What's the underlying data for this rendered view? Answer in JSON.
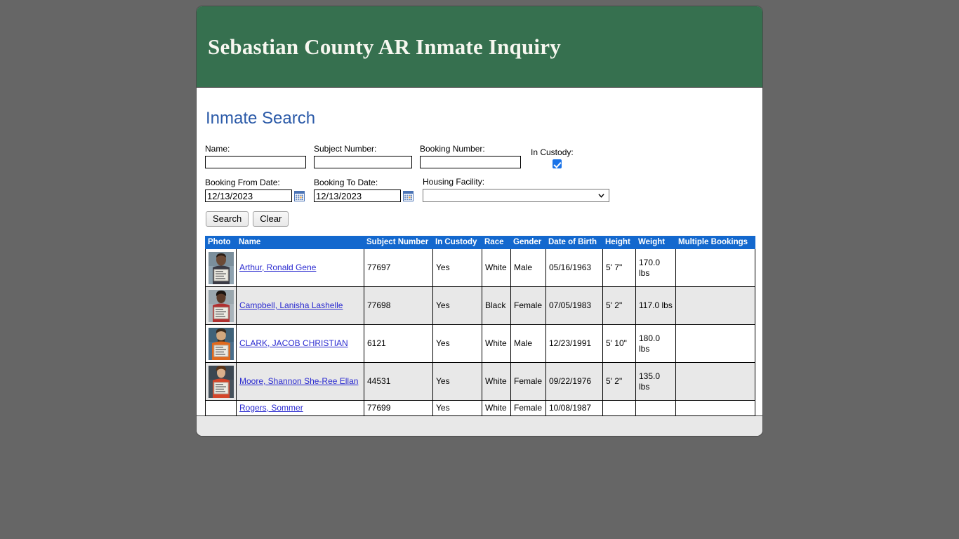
{
  "banner": {
    "title": "Sebastian County AR Inmate Inquiry",
    "bg_color": "#36704f",
    "text_color": "#f7f7f0"
  },
  "section": {
    "title": "Inmate Search",
    "title_color": "#2b5aa8"
  },
  "search_form": {
    "name": {
      "label": "Name:",
      "value": "",
      "placeholder": ""
    },
    "subject_number": {
      "label": "Subject Number:",
      "value": "",
      "placeholder": ""
    },
    "booking_number": {
      "label": "Booking Number:",
      "value": "",
      "placeholder": ""
    },
    "in_custody": {
      "label": "In Custody:",
      "checked": "true",
      "color": "#1a73e8"
    },
    "booking_from_date": {
      "label": "Booking From Date:",
      "value": "12/13/2023",
      "icon": "calendar-icon"
    },
    "booking_to_date": {
      "label": "Booking To Date:",
      "value": "12/13/2023",
      "icon": "calendar-icon"
    },
    "housing_facility": {
      "label": "Housing Facility:",
      "selected": "",
      "options": [
        ""
      ]
    },
    "search_button": "Search",
    "clear_button": "Clear"
  },
  "results": {
    "header_bg": "#1368ce",
    "columns": [
      "Photo",
      "Name",
      "Subject Number",
      "In Custody",
      "Race",
      "Gender",
      "Date of Birth",
      "Height",
      "Weight",
      "Multiple Bookings"
    ],
    "rows": [
      {
        "photo": "mugshot",
        "name": "Arthur, Ronald Gene",
        "subject_number": "77697",
        "in_custody": "Yes",
        "race": "White",
        "gender": "Male",
        "date_of_birth": "05/16/1963",
        "height": "5' 7\"",
        "weight": "170.0 lbs",
        "multiple_bookings": ""
      },
      {
        "photo": "mugshot",
        "name": "Campbell, Lanisha Lashelle",
        "subject_number": "77698",
        "in_custody": "Yes",
        "race": "Black",
        "gender": "Female",
        "date_of_birth": "07/05/1983",
        "height": "5' 2\"",
        "weight": "117.0 lbs",
        "multiple_bookings": ""
      },
      {
        "photo": "mugshot",
        "name": "CLARK, JACOB CHRISTIAN",
        "subject_number": "6121",
        "in_custody": "Yes",
        "race": "White",
        "gender": "Male",
        "date_of_birth": "12/23/1991",
        "height": "5' 10\"",
        "weight": "180.0 lbs",
        "multiple_bookings": ""
      },
      {
        "photo": "mugshot",
        "name": "Moore, Shannon She-Ree Ellan",
        "subject_number": "44531",
        "in_custody": "Yes",
        "race": "White",
        "gender": "Female",
        "date_of_birth": "09/22/1976",
        "height": "5' 2\"",
        "weight": "135.0 lbs",
        "multiple_bookings": ""
      },
      {
        "photo": "",
        "name": "Rogers, Sommer",
        "subject_number": "77699",
        "in_custody": "Yes",
        "race": "White",
        "gender": "Female",
        "date_of_birth": "10/08/1987",
        "height": "",
        "weight": "",
        "multiple_bookings": ""
      }
    ]
  }
}
